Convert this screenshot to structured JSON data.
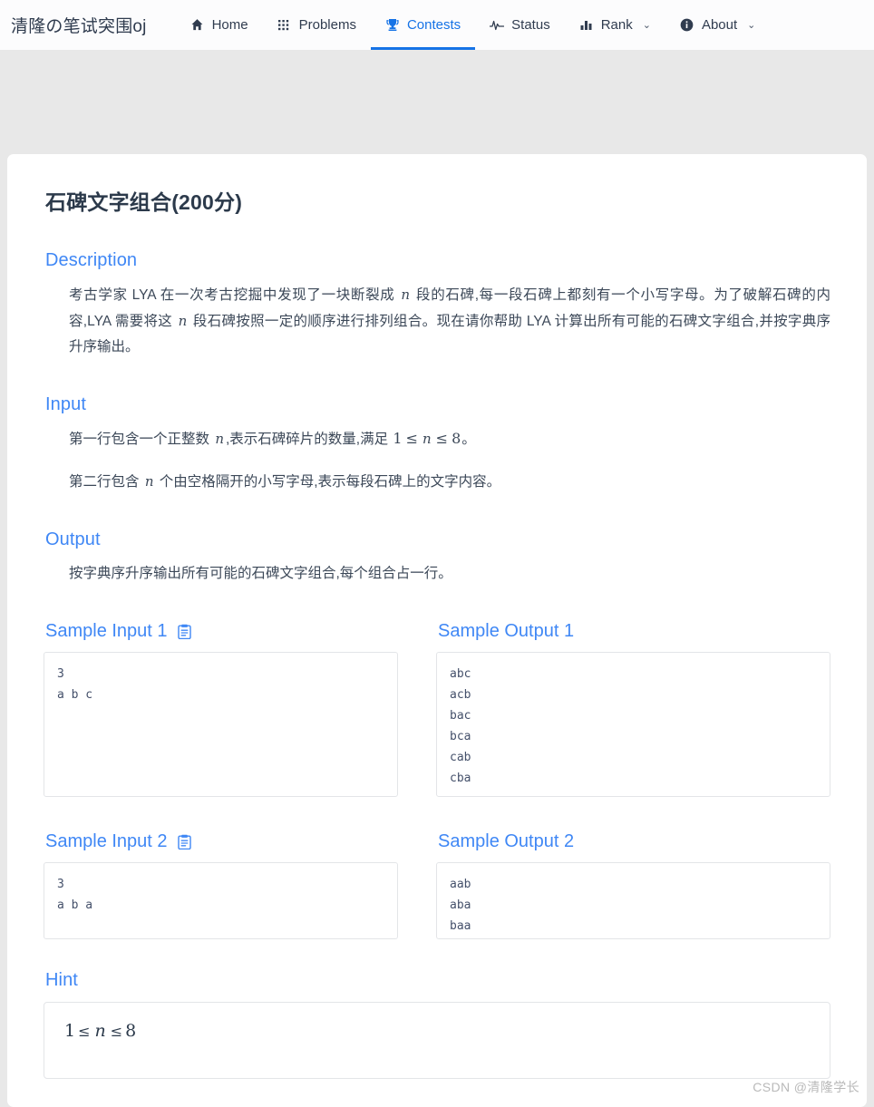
{
  "navbar": {
    "brand": "清隆の笔试突围oj",
    "items": [
      {
        "label": "Home",
        "icon": "home-icon",
        "active": false,
        "caret": ""
      },
      {
        "label": "Problems",
        "icon": "grid-icon",
        "active": false,
        "caret": ""
      },
      {
        "label": "Contests",
        "icon": "trophy-icon",
        "active": true,
        "caret": ""
      },
      {
        "label": "Status",
        "icon": "activity-icon",
        "active": false,
        "caret": ""
      },
      {
        "label": "Rank",
        "icon": "bars-icon",
        "active": false,
        "caret": "⌄"
      },
      {
        "label": "About",
        "icon": "info-icon",
        "active": false,
        "caret": "⌄"
      }
    ],
    "accent_color": "#1673e6"
  },
  "problem": {
    "title": "石碑文字组合(200分)",
    "sections": {
      "description_heading": "Description",
      "description_p1_a": "考古学家 LYA 在一次考古挖掘中发现了一块断裂成 ",
      "description_n1": "n",
      "description_p1_b": " 段的石碑,每一段石碑上都刻有一个小写字母。为了破解石碑的内容,LYA 需要将这 ",
      "description_n2": "n",
      "description_p1_c": " 段石碑按照一定的顺序进行排列组合。现在请你帮助 LYA 计算出所有可能的石碑文字组合,并按字典序升序输出。",
      "input_heading": "Input",
      "input_p1_a": "第一行包含一个正整数 ",
      "input_p1_n": "n",
      "input_p1_b": ",表示石碑碎片的数量,满足 ",
      "input_p1_lo": "1",
      "input_p1_le1": "≤",
      "input_p1_var": "n",
      "input_p1_le2": "≤",
      "input_p1_hi": "8",
      "input_p1_end": "。",
      "input_p2_a": "第二行包含 ",
      "input_p2_n": "n",
      "input_p2_b": " 个由空格隔开的小写字母,表示每段石碑上的文字内容。",
      "output_heading": "Output",
      "output_p1": "按字典序升序输出所有可能的石碑文字组合,每个组合占一行。",
      "hint_heading": "Hint",
      "hint_lo": "1",
      "hint_le1": "≤",
      "hint_var": "n",
      "hint_le2": "≤",
      "hint_hi": "8"
    },
    "samples": [
      {
        "input_label": "Sample Input 1",
        "output_label": "Sample Output 1",
        "input_has_copy": true,
        "output_has_copy": false,
        "input_text": "3\na b c",
        "output_text": "abc\nacb\nbac\nbca\ncab\ncba"
      },
      {
        "input_label": "Sample Input 2",
        "output_label": "Sample Output 2",
        "input_has_copy": true,
        "output_has_copy": false,
        "input_text": "3\na b a",
        "output_text": "aab\naba\nbaa"
      }
    ],
    "heading_color": "#3f87f5"
  },
  "watermark": "CSDN @清隆学长"
}
